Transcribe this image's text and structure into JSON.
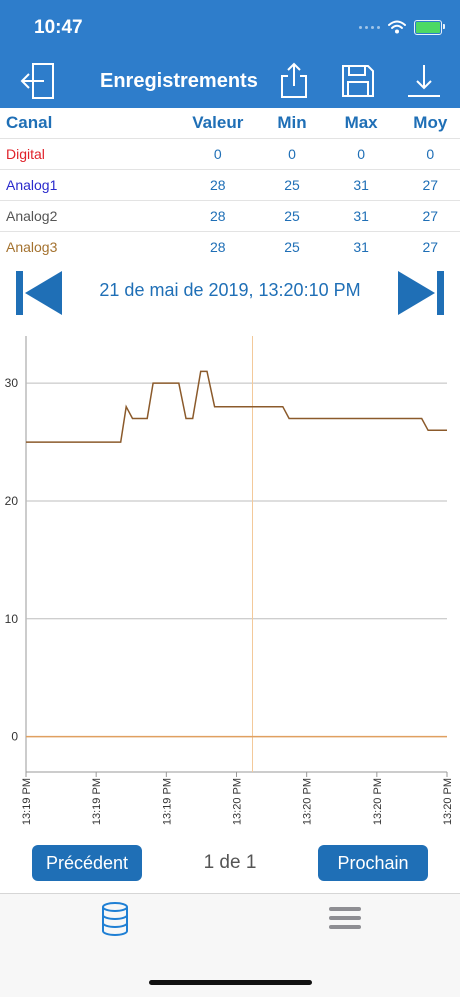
{
  "status": {
    "time": "10:47"
  },
  "header": {
    "title": "Enregistrements"
  },
  "table": {
    "headers": {
      "channel": "Canal",
      "value": "Valeur",
      "min": "Min",
      "max": "Max",
      "avg": "Moy"
    },
    "rows": [
      {
        "channel": "Digital",
        "color": "#e0222a",
        "value": "0",
        "min": "0",
        "max": "0",
        "avg": "0"
      },
      {
        "channel": "Analog1",
        "color": "#2a2acc",
        "value": "28",
        "min": "25",
        "max": "31",
        "avg": "27"
      },
      {
        "channel": "Analog2",
        "color": "#555555",
        "value": "28",
        "min": "25",
        "max": "31",
        "avg": "27"
      },
      {
        "channel": "Analog3",
        "color": "#a4722f",
        "value": "28",
        "min": "25",
        "max": "31",
        "avg": "27"
      }
    ]
  },
  "navigation": {
    "date": "21 de mai de 2019, 13:20:10 PM"
  },
  "chart_data": {
    "type": "line",
    "ylim": [
      -3,
      34
    ],
    "y_ticks": [
      0,
      10,
      20,
      30
    ],
    "x_tick_labels": [
      "13:19 PM",
      "13:19 PM",
      "13:19 PM",
      "13:20 PM",
      "13:20 PM",
      "13:20 PM",
      "13:20 PM"
    ],
    "grid": true,
    "cursor_fraction": 0.538,
    "series": [
      {
        "color": "#8b5a2b",
        "x": [
          0,
          0.225,
          0.238,
          0.253,
          0.288,
          0.302,
          0.363,
          0.38,
          0.396,
          0.415,
          0.43,
          0.448,
          0.61,
          0.625,
          0.94,
          0.955,
          1.0
        ],
        "values": [
          25,
          25,
          28,
          27,
          27,
          30,
          30,
          27,
          27,
          31,
          31,
          28,
          28,
          27,
          27,
          26,
          26
        ]
      },
      {
        "color": "#e0a060",
        "x": [
          0,
          1.0
        ],
        "values": [
          0,
          0
        ]
      }
    ]
  },
  "pagination": {
    "previous": "Précédent",
    "page": "1 de 1",
    "next": "Prochain"
  }
}
